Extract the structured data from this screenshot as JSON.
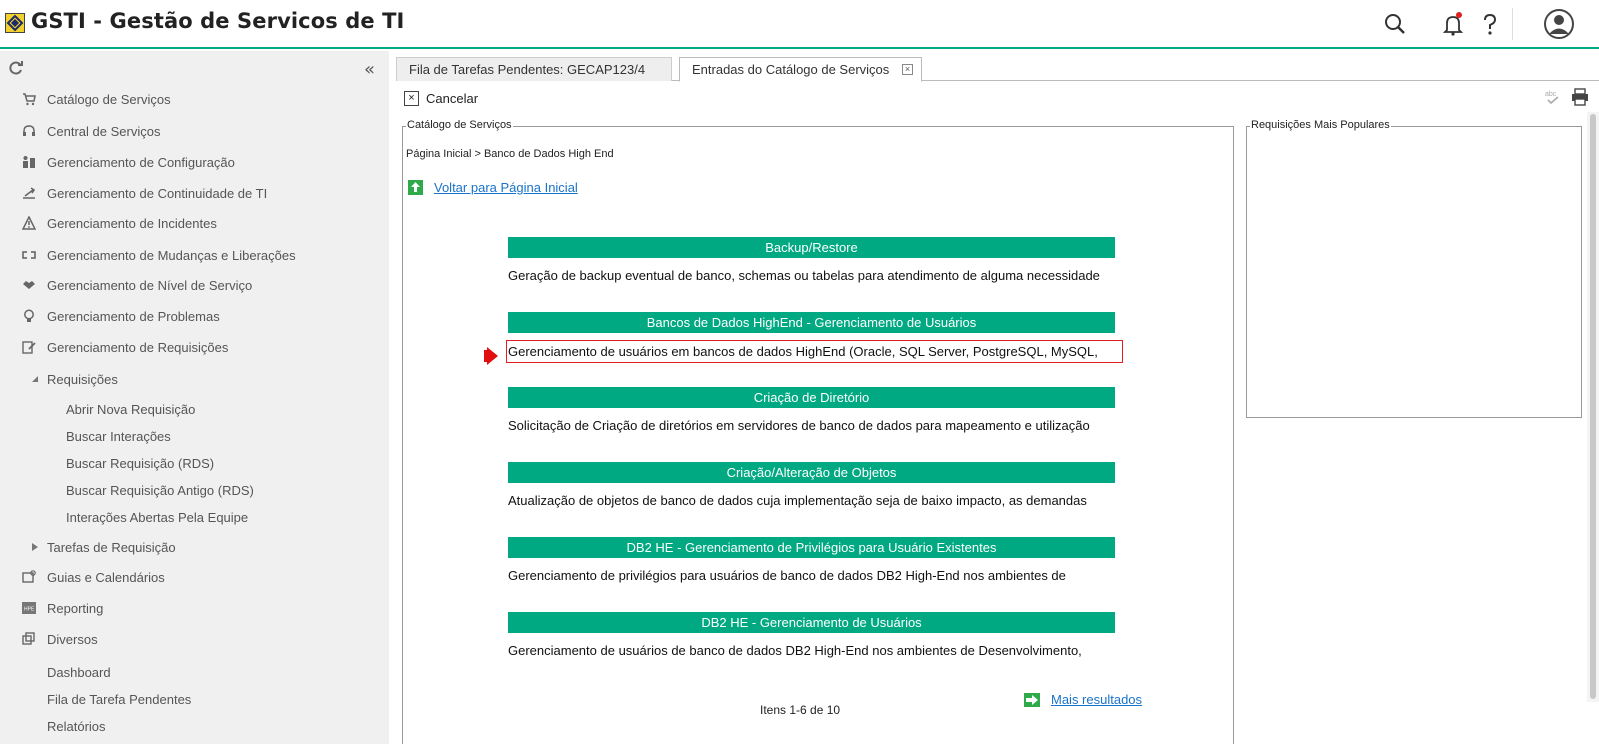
{
  "header": {
    "title": "GSTI - Gestão de Servicos de TI",
    "icons": [
      "search-icon",
      "notification-bell-icon",
      "help-icon",
      "user-avatar-icon"
    ],
    "accent_color": "#01a982"
  },
  "sidebar": {
    "items": [
      {
        "label": "Catálogo de Serviços",
        "icon": "cart-icon"
      },
      {
        "label": "Central de Serviços",
        "icon": "headset-icon"
      },
      {
        "label": "Gerenciamento de Configuração",
        "icon": "config-icon"
      },
      {
        "label": "Gerenciamento de Continuidade de TI",
        "icon": "continuity-icon"
      },
      {
        "label": "Gerenciamento de Incidentes",
        "icon": "warning-icon"
      },
      {
        "label": "Gerenciamento de Mudanças e Liberações",
        "icon": "change-icon"
      },
      {
        "label": "Gerenciamento de Nível de Serviço",
        "icon": "handshake-icon"
      },
      {
        "label": "Gerenciamento de Problemas",
        "icon": "lightbulb-icon"
      },
      {
        "label": "Gerenciamento de Requisições",
        "icon": "edit-doc-icon"
      }
    ],
    "requisicoes": {
      "label": "Requisições",
      "children": [
        "Abrir Nova Requisição",
        "Buscar Interações",
        "Buscar Requisição (RDS)",
        "Buscar Requisição Antigo (RDS)",
        "Interações Abertas Pela Equipe"
      ]
    },
    "tarefas": "Tarefas de Requisição",
    "guias": "Guias e Calendários",
    "reporting": "Reporting",
    "diversos": "Diversos",
    "extra": [
      "Dashboard",
      "Fila de Tarefa Pendentes",
      "Relatórios"
    ]
  },
  "tabs": [
    {
      "label": "Fila de Tarefas Pendentes: GECAP123/4",
      "active": false
    },
    {
      "label": "Entradas do Catálogo de Serviços",
      "active": true
    }
  ],
  "toolbar": {
    "cancel_label": "Cancelar"
  },
  "catalog": {
    "legend": "Catálogo de Serviços",
    "breadcrumb": "Página Inicial > Banco de Dados High End",
    "back_link": "Voltar para Página Inicial",
    "entries": [
      {
        "title": "Backup/Restore",
        "desc": "Geração de backup eventual de banco, schemas ou tabelas para atendimento de alguma necessidade"
      },
      {
        "title": "Bancos de Dados HighEnd - Gerenciamento de Usuários",
        "desc": "Gerenciamento de usuários em bancos de dados HighEnd (Oracle, SQL Server, PostgreSQL, MySQL,"
      },
      {
        "title": "Criação de Diretório",
        "desc": "Solicitação de Criação de diretórios em servidores de banco de dados para mapeamento e utilização"
      },
      {
        "title": "Criação/Alteração de Objetos",
        "desc": "Atualização de objetos de banco de dados cuja implementação seja de baixo impacto, as demandas"
      },
      {
        "title": "DB2 HE - Gerenciamento de Privilégios para Usuário Existentes",
        "desc": "Gerenciamento de privilégios para usuários de banco de dados DB2 High-End nos ambientes de"
      },
      {
        "title": "DB2 HE - Gerenciamento de Usuários",
        "desc": "Gerenciamento de usuários de banco de dados DB2 High-End nos ambientes de Desenvolvimento,"
      }
    ],
    "pager": "Itens 1-6 de 10",
    "more_link": "Mais resultados"
  },
  "popular": {
    "legend": "Requisições Mais Populares"
  }
}
